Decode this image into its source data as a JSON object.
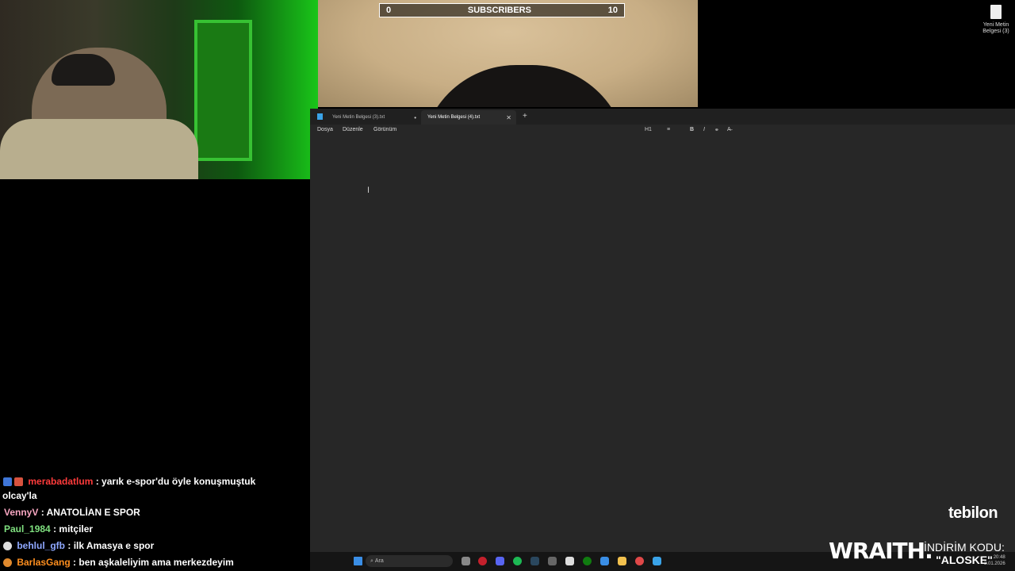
{
  "subscribers": {
    "left": "0",
    "label": "SUBSCRIBERS",
    "right": "10"
  },
  "desktop_icon": {
    "label": "Yeni Metin Belgesi (3)"
  },
  "notepad": {
    "tabs": [
      {
        "label": "Yeni Metin Belgesi (3).txt",
        "marker": "•"
      },
      {
        "label": "Yeni Metin Belgesi (4).txt",
        "close": "✕"
      }
    ],
    "add_tab": "+",
    "menu": [
      "Dosya",
      "Düzenle",
      "Görünüm"
    ],
    "format": {
      "heading": "H1",
      "list": "≡",
      "bold": "B",
      "italic": "I",
      "link": "⚭",
      "clear": "A̶"
    },
    "caret": "I"
  },
  "chat": [
    {
      "user": "merabadatlum",
      "message": ": yarık e-spor'du öyle konuşmuştuk",
      "continuation": "olcay'la"
    },
    {
      "user": "VennyV",
      "message": ": ANATOLİAN E SPOR"
    },
    {
      "user": "Paul_1984",
      "message": ": mitçiler"
    },
    {
      "user": "behlul_gfb",
      "message": ": ilk Amasya e spor"
    },
    {
      "user": "BarlasGang",
      "message": ": ben aşkaleliyim ama merkezdeyim"
    }
  ],
  "taskbar": {
    "search_placeholder": "Ara",
    "time": "20:48",
    "date": "3.01.2026"
  },
  "overlay": {
    "brand": "tebilon",
    "sponsor": "WRAITH.",
    "promo_label": "İNDİRİM KODU:",
    "promo_code": "\"ALOSKE\""
  },
  "colors": {
    "accent": "#3aa3e8"
  }
}
